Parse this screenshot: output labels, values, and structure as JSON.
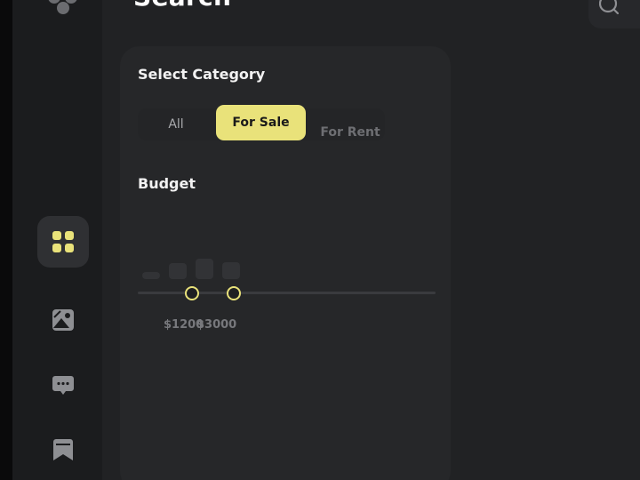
{
  "colors": {
    "accent": "#e9e27a",
    "background": "#212224",
    "panel": "#262729",
    "sidebar": "#1b1c1e",
    "muted_text": "#77787c"
  },
  "sidebar": {
    "logo_icon": "logo-dots-icon",
    "items": [
      {
        "id": "dashboard",
        "icon": "grid-icon",
        "active": true
      },
      {
        "id": "gallery",
        "icon": "image-icon",
        "active": false
      },
      {
        "id": "messages",
        "icon": "chat-icon",
        "active": false
      },
      {
        "id": "saved",
        "icon": "bookmark-icon",
        "active": false
      }
    ]
  },
  "header": {
    "title": "Search",
    "search_icon": "search-icon"
  },
  "filters": {
    "category_label": "Select Category",
    "categories": [
      {
        "label": "All",
        "selected": false
      },
      {
        "label": "For Sale",
        "selected": true
      },
      {
        "label": "For Rent",
        "selected": false
      }
    ],
    "budget_label": "Budget",
    "budget": {
      "min_label": "$1200",
      "max_label": "$3000",
      "histogram": [
        0.35,
        0.75,
        0.95,
        0.8
      ]
    }
  }
}
